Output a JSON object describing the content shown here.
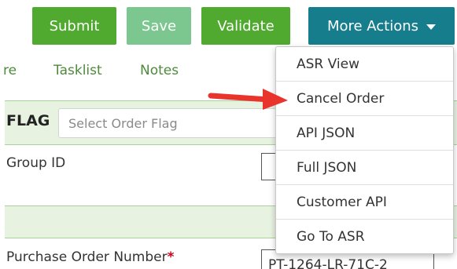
{
  "toolbar": {
    "submit_label": "Submit",
    "save_label": "Save",
    "validate_label": "Validate",
    "more_actions_label": "More Actions",
    "colors": {
      "green": "#4faa2f",
      "light_green": "#7cc790",
      "teal": "#167d8c"
    }
  },
  "tabs": [
    {
      "label": "re"
    },
    {
      "label": "Tasklist"
    },
    {
      "label": "Notes"
    }
  ],
  "form": {
    "flag_label": "FLAG",
    "order_flag_placeholder": "Select Order Flag",
    "group_id_label": "Group ID",
    "po_label": "Purchase Order Number",
    "po_required_mark": "*",
    "po_value": "PT-1264-LR-71C-2"
  },
  "more_actions_menu": {
    "items": [
      {
        "label": "ASR View"
      },
      {
        "label": "Cancel Order"
      },
      {
        "label": "API JSON"
      },
      {
        "label": "Full JSON"
      },
      {
        "label": "Customer API"
      },
      {
        "label": "Go To ASR"
      }
    ]
  },
  "annotation": {
    "arrow_color": "#e8342c",
    "points_to": "Cancel Order"
  }
}
